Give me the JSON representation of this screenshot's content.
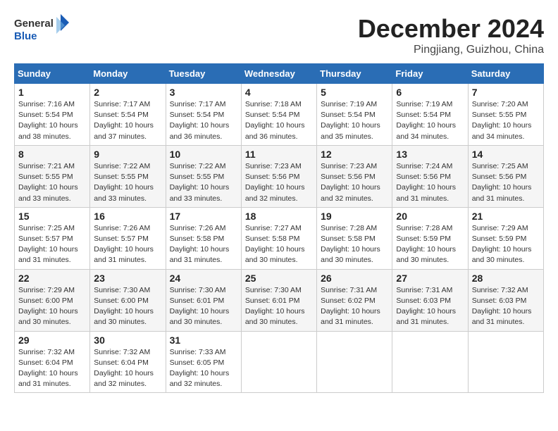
{
  "logo": {
    "general": "General",
    "blue": "Blue"
  },
  "title": {
    "month": "December 2024",
    "location": "Pingjiang, Guizhou, China"
  },
  "calendar": {
    "headers": [
      "Sunday",
      "Monday",
      "Tuesday",
      "Wednesday",
      "Thursday",
      "Friday",
      "Saturday"
    ],
    "weeks": [
      [
        null,
        null,
        null,
        null,
        null,
        null,
        null
      ]
    ],
    "rows": [
      [
        {
          "day": "1",
          "sunrise": "7:16 AM",
          "sunset": "5:54 PM",
          "daylight": "10 hours and 38 minutes."
        },
        {
          "day": "2",
          "sunrise": "7:17 AM",
          "sunset": "5:54 PM",
          "daylight": "10 hours and 37 minutes."
        },
        {
          "day": "3",
          "sunrise": "7:17 AM",
          "sunset": "5:54 PM",
          "daylight": "10 hours and 36 minutes."
        },
        {
          "day": "4",
          "sunrise": "7:18 AM",
          "sunset": "5:54 PM",
          "daylight": "10 hours and 36 minutes."
        },
        {
          "day": "5",
          "sunrise": "7:19 AM",
          "sunset": "5:54 PM",
          "daylight": "10 hours and 35 minutes."
        },
        {
          "day": "6",
          "sunrise": "7:19 AM",
          "sunset": "5:54 PM",
          "daylight": "10 hours and 34 minutes."
        },
        {
          "day": "7",
          "sunrise": "7:20 AM",
          "sunset": "5:55 PM",
          "daylight": "10 hours and 34 minutes."
        }
      ],
      [
        {
          "day": "8",
          "sunrise": "7:21 AM",
          "sunset": "5:55 PM",
          "daylight": "10 hours and 33 minutes."
        },
        {
          "day": "9",
          "sunrise": "7:22 AM",
          "sunset": "5:55 PM",
          "daylight": "10 hours and 33 minutes."
        },
        {
          "day": "10",
          "sunrise": "7:22 AM",
          "sunset": "5:55 PM",
          "daylight": "10 hours and 33 minutes."
        },
        {
          "day": "11",
          "sunrise": "7:23 AM",
          "sunset": "5:56 PM",
          "daylight": "10 hours and 32 minutes."
        },
        {
          "day": "12",
          "sunrise": "7:23 AM",
          "sunset": "5:56 PM",
          "daylight": "10 hours and 32 minutes."
        },
        {
          "day": "13",
          "sunrise": "7:24 AM",
          "sunset": "5:56 PM",
          "daylight": "10 hours and 31 minutes."
        },
        {
          "day": "14",
          "sunrise": "7:25 AM",
          "sunset": "5:56 PM",
          "daylight": "10 hours and 31 minutes."
        }
      ],
      [
        {
          "day": "15",
          "sunrise": "7:25 AM",
          "sunset": "5:57 PM",
          "daylight": "10 hours and 31 minutes."
        },
        {
          "day": "16",
          "sunrise": "7:26 AM",
          "sunset": "5:57 PM",
          "daylight": "10 hours and 31 minutes."
        },
        {
          "day": "17",
          "sunrise": "7:26 AM",
          "sunset": "5:58 PM",
          "daylight": "10 hours and 31 minutes."
        },
        {
          "day": "18",
          "sunrise": "7:27 AM",
          "sunset": "5:58 PM",
          "daylight": "10 hours and 30 minutes."
        },
        {
          "day": "19",
          "sunrise": "7:28 AM",
          "sunset": "5:58 PM",
          "daylight": "10 hours and 30 minutes."
        },
        {
          "day": "20",
          "sunrise": "7:28 AM",
          "sunset": "5:59 PM",
          "daylight": "10 hours and 30 minutes."
        },
        {
          "day": "21",
          "sunrise": "7:29 AM",
          "sunset": "5:59 PM",
          "daylight": "10 hours and 30 minutes."
        }
      ],
      [
        {
          "day": "22",
          "sunrise": "7:29 AM",
          "sunset": "6:00 PM",
          "daylight": "10 hours and 30 minutes."
        },
        {
          "day": "23",
          "sunrise": "7:30 AM",
          "sunset": "6:00 PM",
          "daylight": "10 hours and 30 minutes."
        },
        {
          "day": "24",
          "sunrise": "7:30 AM",
          "sunset": "6:01 PM",
          "daylight": "10 hours and 30 minutes."
        },
        {
          "day": "25",
          "sunrise": "7:30 AM",
          "sunset": "6:01 PM",
          "daylight": "10 hours and 30 minutes."
        },
        {
          "day": "26",
          "sunrise": "7:31 AM",
          "sunset": "6:02 PM",
          "daylight": "10 hours and 31 minutes."
        },
        {
          "day": "27",
          "sunrise": "7:31 AM",
          "sunset": "6:03 PM",
          "daylight": "10 hours and 31 minutes."
        },
        {
          "day": "28",
          "sunrise": "7:32 AM",
          "sunset": "6:03 PM",
          "daylight": "10 hours and 31 minutes."
        }
      ],
      [
        {
          "day": "29",
          "sunrise": "7:32 AM",
          "sunset": "6:04 PM",
          "daylight": "10 hours and 31 minutes."
        },
        {
          "day": "30",
          "sunrise": "7:32 AM",
          "sunset": "6:04 PM",
          "daylight": "10 hours and 32 minutes."
        },
        {
          "day": "31",
          "sunrise": "7:33 AM",
          "sunset": "6:05 PM",
          "daylight": "10 hours and 32 minutes."
        },
        null,
        null,
        null,
        null
      ]
    ]
  }
}
